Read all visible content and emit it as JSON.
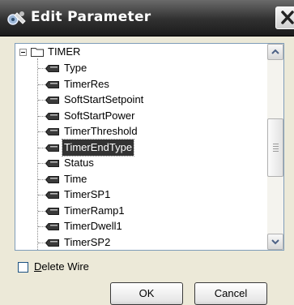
{
  "dialog": {
    "title": "Edit Parameter",
    "icons": {
      "title_icon": "tool-gear-icon",
      "close_icon": "close-x-icon"
    }
  },
  "tree": {
    "root": {
      "label": "TIMER",
      "expanded": true,
      "icon": "folder-icon"
    },
    "children": [
      {
        "label": "Type"
      },
      {
        "label": "TimerRes"
      },
      {
        "label": "SoftStartSetpoint"
      },
      {
        "label": "SoftStartPower"
      },
      {
        "label": "TimerThreshold"
      },
      {
        "label": "TimerEndType",
        "selected": true
      },
      {
        "label": "Status"
      },
      {
        "label": "Time"
      },
      {
        "label": "TimerSP1"
      },
      {
        "label": "TimerRamp1"
      },
      {
        "label": "TimerDwell1"
      },
      {
        "label": "TimerSP2"
      }
    ],
    "leaf_icon": "parameter-tag-icon"
  },
  "options": {
    "delete_wire_prefix": "D",
    "delete_wire_rest": "elete Wire",
    "delete_wire_checked": false
  },
  "buttons": {
    "ok": "OK",
    "cancel": "Cancel"
  },
  "colors": {
    "titlebar": "#303030",
    "selection": "#333333",
    "tree_border": "#7f9db9"
  }
}
